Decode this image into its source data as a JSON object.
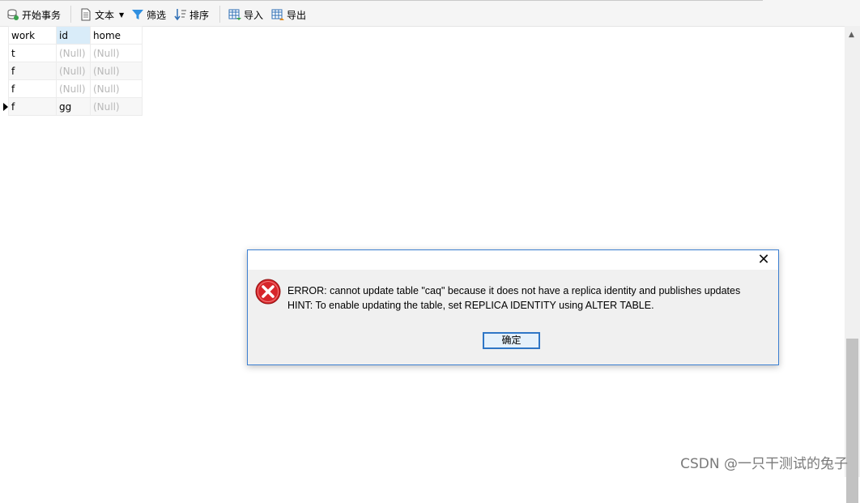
{
  "toolbar": {
    "begin_transaction": "开始事务",
    "text": "文本",
    "filter": "筛选",
    "sort": "排序",
    "import": "导入",
    "export": "导出"
  },
  "grid": {
    "columns": [
      "work",
      "id",
      "home"
    ],
    "rows": [
      [
        "t",
        "(Null)",
        "(Null)"
      ],
      [
        "f",
        "(Null)",
        "(Null)"
      ],
      [
        "f",
        "(Null)",
        "(Null)"
      ],
      [
        "f",
        "gg",
        "(Null)"
      ]
    ]
  },
  "dialog": {
    "close_symbol": "✕",
    "error_line": "ERROR:  cannot update table \"caq\" because it does not have a replica identity and publishes updates",
    "hint_line": "HINT:  To enable updating the table, set REPLICA IDENTITY using ALTER TABLE.",
    "ok_label": "确定"
  },
  "scrollbar": {
    "up_symbol": "▲"
  },
  "watermark": "CSDN @一只干测试的兔子",
  "colors": {
    "dialog_border": "#3c7fd1",
    "error_red": "#d7262b",
    "selected_header": "#d9ecf9",
    "edited_cell": "#fdecf8"
  }
}
